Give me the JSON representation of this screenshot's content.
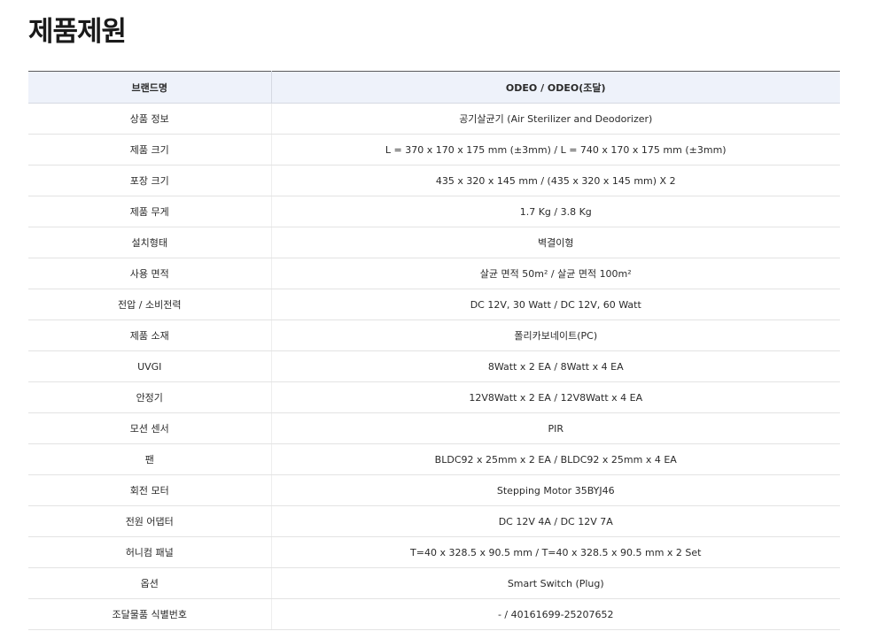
{
  "page": {
    "title": "제품제원"
  },
  "table": {
    "header": {
      "label": "브랜드명",
      "value": "ODEO / ODEO(조달)"
    },
    "rows": [
      {
        "label": "상품 정보",
        "value": "공기살균기 (Air Sterilizer and Deodorizer)"
      },
      {
        "label": "제품 크기",
        "value": "L = 370 x 170 x 175 mm (±3mm) / L = 740 x 170 x 175 mm (±3mm)"
      },
      {
        "label": "포장 크기",
        "value": "435 x 320 x 145 mm / (435 x 320 x 145 mm) X 2"
      },
      {
        "label": "제품 무게",
        "value": "1.7 Kg / 3.8 Kg"
      },
      {
        "label": "설치형태",
        "value": "벽결이형"
      },
      {
        "label": "사용 면적",
        "value": "살균 면적 50m² / 살균 면적 100m²"
      },
      {
        "label": "전압 / 소비전력",
        "value": "DC 12V, 30 Watt / DC 12V, 60 Watt"
      },
      {
        "label": "제품 소재",
        "value": "폴리카보네이트(PC)"
      },
      {
        "label": "UVGI",
        "value": "8Watt x 2 EA / 8Watt x 4 EA"
      },
      {
        "label": "안정기",
        "value": "12V8Watt x 2 EA / 12V8Watt x 4 EA"
      },
      {
        "label": "모션 센서",
        "value": "PIR"
      },
      {
        "label": "팬",
        "value": "BLDC92 x 25mm x 2 EA / BLDC92 x 25mm x 4 EA"
      },
      {
        "label": "회전 모터",
        "value": "Stepping Motor 35BYJ46"
      },
      {
        "label": "전원 어댑터",
        "value": "DC 12V 4A / DC 12V 7A"
      },
      {
        "label": "허니컴 패널",
        "value": "T=40 x 328.5 x 90.5 mm / T=40 x 328.5 x 90.5 mm x 2 Set"
      },
      {
        "label": "옵션",
        "value": "Smart Switch (Plug)"
      },
      {
        "label": "조달물품 식별번호",
        "value": "- / 40161699-25207652"
      }
    ]
  }
}
